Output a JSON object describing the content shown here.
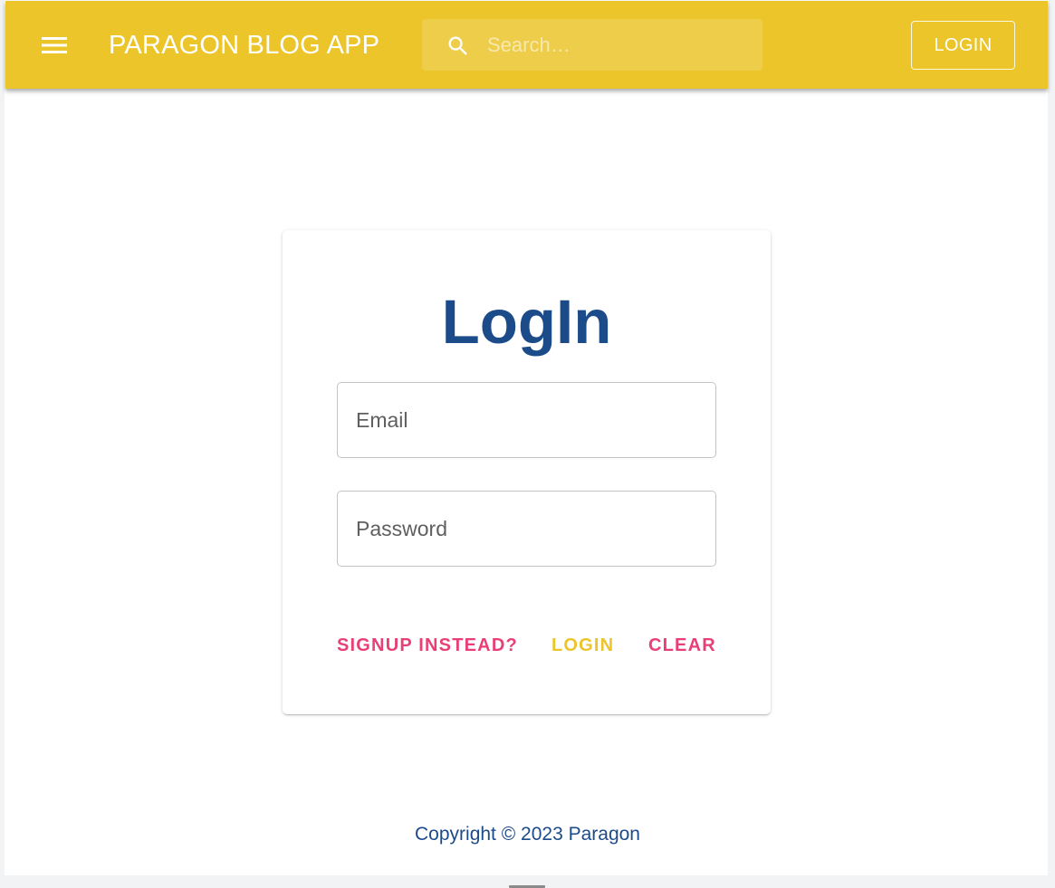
{
  "appbar": {
    "title": "PARAGON BLOG APP",
    "menu_icon": "hamburger-menu-icon",
    "search": {
      "icon": "search-icon",
      "placeholder": "Search…",
      "value": ""
    },
    "login_label": "LOGIN",
    "color": "#ecc52b"
  },
  "login_card": {
    "title": "LogIn",
    "email_placeholder": "Email",
    "password_placeholder": "Password",
    "actions": {
      "signup_label": "SIGNUP INSTEAD?",
      "login_label": "LOGIN",
      "clear_label": "CLEAR"
    }
  },
  "footer": {
    "copyright": "Copyright © 2023 Paragon"
  },
  "colors": {
    "primary": "#ecc52b",
    "secondary": "#e84076",
    "heading": "#1c4b8a"
  }
}
